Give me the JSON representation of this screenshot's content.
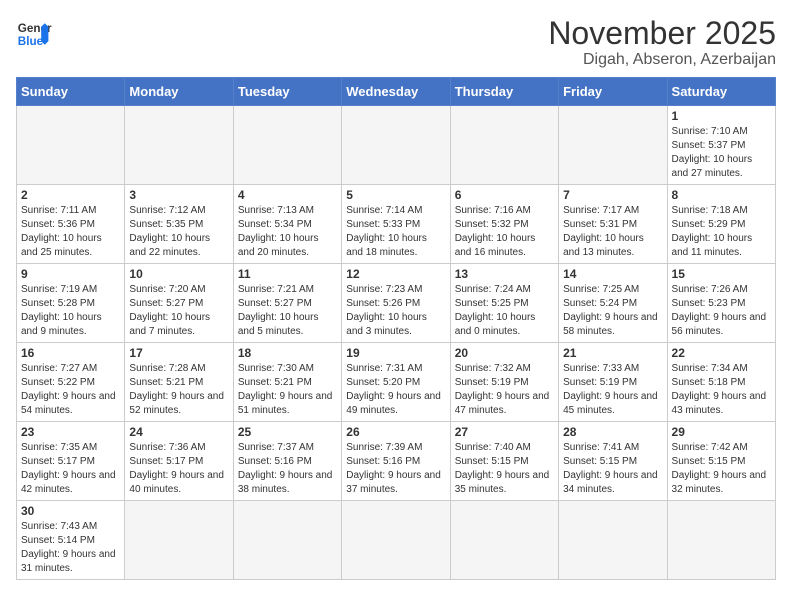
{
  "logo": {
    "general": "General",
    "blue": "Blue"
  },
  "title": "November 2025",
  "location": "Digah, Abseron, Azerbaijan",
  "days_of_week": [
    "Sunday",
    "Monday",
    "Tuesday",
    "Wednesday",
    "Thursday",
    "Friday",
    "Saturday"
  ],
  "weeks": [
    [
      {
        "day": "",
        "info": ""
      },
      {
        "day": "",
        "info": ""
      },
      {
        "day": "",
        "info": ""
      },
      {
        "day": "",
        "info": ""
      },
      {
        "day": "",
        "info": ""
      },
      {
        "day": "",
        "info": ""
      },
      {
        "day": "1",
        "info": "Sunrise: 7:10 AM\nSunset: 5:37 PM\nDaylight: 10 hours and 27 minutes."
      }
    ],
    [
      {
        "day": "2",
        "info": "Sunrise: 7:11 AM\nSunset: 5:36 PM\nDaylight: 10 hours and 25 minutes."
      },
      {
        "day": "3",
        "info": "Sunrise: 7:12 AM\nSunset: 5:35 PM\nDaylight: 10 hours and 22 minutes."
      },
      {
        "day": "4",
        "info": "Sunrise: 7:13 AM\nSunset: 5:34 PM\nDaylight: 10 hours and 20 minutes."
      },
      {
        "day": "5",
        "info": "Sunrise: 7:14 AM\nSunset: 5:33 PM\nDaylight: 10 hours and 18 minutes."
      },
      {
        "day": "6",
        "info": "Sunrise: 7:16 AM\nSunset: 5:32 PM\nDaylight: 10 hours and 16 minutes."
      },
      {
        "day": "7",
        "info": "Sunrise: 7:17 AM\nSunset: 5:31 PM\nDaylight: 10 hours and 13 minutes."
      },
      {
        "day": "8",
        "info": "Sunrise: 7:18 AM\nSunset: 5:29 PM\nDaylight: 10 hours and 11 minutes."
      }
    ],
    [
      {
        "day": "9",
        "info": "Sunrise: 7:19 AM\nSunset: 5:28 PM\nDaylight: 10 hours and 9 minutes."
      },
      {
        "day": "10",
        "info": "Sunrise: 7:20 AM\nSunset: 5:27 PM\nDaylight: 10 hours and 7 minutes."
      },
      {
        "day": "11",
        "info": "Sunrise: 7:21 AM\nSunset: 5:27 PM\nDaylight: 10 hours and 5 minutes."
      },
      {
        "day": "12",
        "info": "Sunrise: 7:23 AM\nSunset: 5:26 PM\nDaylight: 10 hours and 3 minutes."
      },
      {
        "day": "13",
        "info": "Sunrise: 7:24 AM\nSunset: 5:25 PM\nDaylight: 10 hours and 0 minutes."
      },
      {
        "day": "14",
        "info": "Sunrise: 7:25 AM\nSunset: 5:24 PM\nDaylight: 9 hours and 58 minutes."
      },
      {
        "day": "15",
        "info": "Sunrise: 7:26 AM\nSunset: 5:23 PM\nDaylight: 9 hours and 56 minutes."
      }
    ],
    [
      {
        "day": "16",
        "info": "Sunrise: 7:27 AM\nSunset: 5:22 PM\nDaylight: 9 hours and 54 minutes."
      },
      {
        "day": "17",
        "info": "Sunrise: 7:28 AM\nSunset: 5:21 PM\nDaylight: 9 hours and 52 minutes."
      },
      {
        "day": "18",
        "info": "Sunrise: 7:30 AM\nSunset: 5:21 PM\nDaylight: 9 hours and 51 minutes."
      },
      {
        "day": "19",
        "info": "Sunrise: 7:31 AM\nSunset: 5:20 PM\nDaylight: 9 hours and 49 minutes."
      },
      {
        "day": "20",
        "info": "Sunrise: 7:32 AM\nSunset: 5:19 PM\nDaylight: 9 hours and 47 minutes."
      },
      {
        "day": "21",
        "info": "Sunrise: 7:33 AM\nSunset: 5:19 PM\nDaylight: 9 hours and 45 minutes."
      },
      {
        "day": "22",
        "info": "Sunrise: 7:34 AM\nSunset: 5:18 PM\nDaylight: 9 hours and 43 minutes."
      }
    ],
    [
      {
        "day": "23",
        "info": "Sunrise: 7:35 AM\nSunset: 5:17 PM\nDaylight: 9 hours and 42 minutes."
      },
      {
        "day": "24",
        "info": "Sunrise: 7:36 AM\nSunset: 5:17 PM\nDaylight: 9 hours and 40 minutes."
      },
      {
        "day": "25",
        "info": "Sunrise: 7:37 AM\nSunset: 5:16 PM\nDaylight: 9 hours and 38 minutes."
      },
      {
        "day": "26",
        "info": "Sunrise: 7:39 AM\nSunset: 5:16 PM\nDaylight: 9 hours and 37 minutes."
      },
      {
        "day": "27",
        "info": "Sunrise: 7:40 AM\nSunset: 5:15 PM\nDaylight: 9 hours and 35 minutes."
      },
      {
        "day": "28",
        "info": "Sunrise: 7:41 AM\nSunset: 5:15 PM\nDaylight: 9 hours and 34 minutes."
      },
      {
        "day": "29",
        "info": "Sunrise: 7:42 AM\nSunset: 5:15 PM\nDaylight: 9 hours and 32 minutes."
      }
    ],
    [
      {
        "day": "30",
        "info": "Sunrise: 7:43 AM\nSunset: 5:14 PM\nDaylight: 9 hours and 31 minutes."
      },
      {
        "day": "",
        "info": ""
      },
      {
        "day": "",
        "info": ""
      },
      {
        "day": "",
        "info": ""
      },
      {
        "day": "",
        "info": ""
      },
      {
        "day": "",
        "info": ""
      },
      {
        "day": "",
        "info": ""
      }
    ]
  ]
}
